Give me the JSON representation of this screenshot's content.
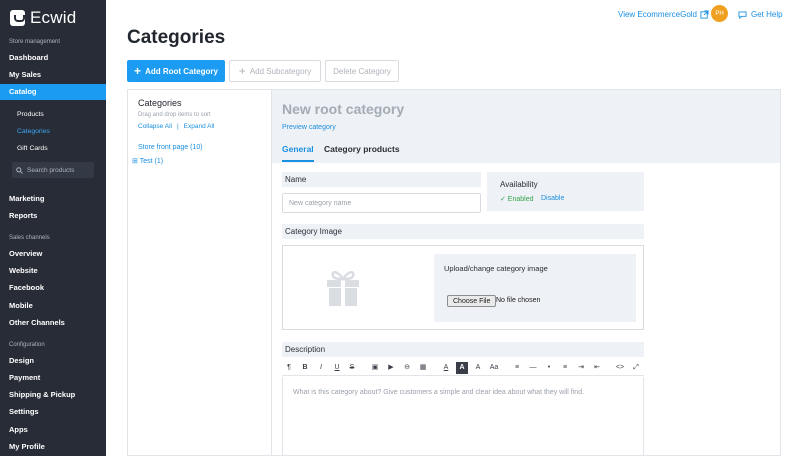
{
  "app": {
    "logo_text": "Ecwid"
  },
  "sidebar": {
    "sections": {
      "store": "Store management",
      "channels": "Sales channels",
      "config": "Configuration"
    },
    "items": {
      "dashboard": "Dashboard",
      "mysales": "My Sales",
      "catalog": "Catalog",
      "marketing": "Marketing",
      "reports": "Reports",
      "overview": "Overview",
      "website": "Website",
      "facebook": "Facebook",
      "mobile": "Mobile",
      "other": "Other Channels",
      "design": "Design",
      "payment": "Payment",
      "shipping": "Shipping & Pickup",
      "settings": "Settings",
      "apps": "Apps",
      "profile": "My Profile"
    },
    "catalog_sub": {
      "products": "Products",
      "categories": "Categories",
      "giftcards": "Gift Cards"
    },
    "search_placeholder": "Search products"
  },
  "header": {
    "title": "Categories",
    "view_store": "View EcommerceGold",
    "avatar": "PH",
    "help": "Get Help"
  },
  "actions": {
    "add_root": "Add Root Category",
    "add_sub": "Add Subcategory",
    "delete": "Delete Category"
  },
  "tree": {
    "title": "Categories",
    "hint": "Drag and drop items to sort",
    "collapse": "Collapse All",
    "separator": "|",
    "expand": "Expand All",
    "store_front": "Store front page (10)",
    "node": "Test (1)"
  },
  "editor": {
    "title": "New root category",
    "preview": "Preview category",
    "tabs": {
      "general": "General",
      "products": "Category products"
    },
    "name_label": "Name",
    "name_placeholder": "New category name",
    "availability": {
      "title": "Availability",
      "enabled": "✓ Enabled",
      "disable": "Disable"
    },
    "image_label": "Category Image",
    "upload_title": "Upload/change category image",
    "choose_file": "Choose File",
    "no_file": "No file chosen",
    "description_label": "Description",
    "description_placeholder": "What is this category about? Give customers a simple and clear idea about what they will find."
  },
  "toolbar": {
    "paragraph": "¶",
    "bold": "B",
    "italic": "I",
    "underline": "U",
    "strike": "S",
    "image": "▣",
    "video": "▶",
    "link": "⊖",
    "table": "▦",
    "text_color": "A",
    "bg_color": "A",
    "font_size": "A",
    "font_family": "Aa",
    "align": "≡",
    "hr": "—",
    "ul": "•",
    "ol": "≡",
    "indent": "⇥",
    "outdent": "⇤",
    "code": "<>",
    "fullscreen": "⤢"
  },
  "colors": {
    "accent": "#1b9cf2",
    "sidebar": "#272c36",
    "success": "#35a24a"
  }
}
